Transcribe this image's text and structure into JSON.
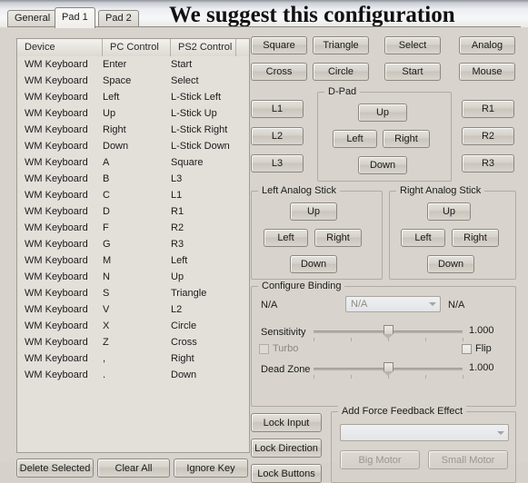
{
  "title": "We suggest this configuration",
  "tabs": [
    {
      "id": "general",
      "label": "General",
      "active": false
    },
    {
      "id": "pad1",
      "label": "Pad 1",
      "active": true
    },
    {
      "id": "pad2",
      "label": "Pad 2",
      "active": false
    }
  ],
  "table": {
    "columns": [
      "Device",
      "PC Control",
      "PS2 Control",
      ""
    ],
    "rows": [
      {
        "device": "WM Keyboard",
        "pc": "Enter",
        "ps2": "Start"
      },
      {
        "device": "WM Keyboard",
        "pc": "Space",
        "ps2": "Select"
      },
      {
        "device": "WM Keyboard",
        "pc": "Left",
        "ps2": "L-Stick Left"
      },
      {
        "device": "WM Keyboard",
        "pc": "Up",
        "ps2": "L-Stick Up"
      },
      {
        "device": "WM Keyboard",
        "pc": "Right",
        "ps2": "L-Stick Right"
      },
      {
        "device": "WM Keyboard",
        "pc": "Down",
        "ps2": "L-Stick Down"
      },
      {
        "device": "WM Keyboard",
        "pc": "A",
        "ps2": "Square"
      },
      {
        "device": "WM Keyboard",
        "pc": "B",
        "ps2": "L3"
      },
      {
        "device": "WM Keyboard",
        "pc": "C",
        "ps2": "L1"
      },
      {
        "device": "WM Keyboard",
        "pc": "D",
        "ps2": "R1"
      },
      {
        "device": "WM Keyboard",
        "pc": "F",
        "ps2": "R2"
      },
      {
        "device": "WM Keyboard",
        "pc": "G",
        "ps2": "R3"
      },
      {
        "device": "WM Keyboard",
        "pc": "M",
        "ps2": "Left"
      },
      {
        "device": "WM Keyboard",
        "pc": "N",
        "ps2": "Up"
      },
      {
        "device": "WM Keyboard",
        "pc": "S",
        "ps2": "Triangle"
      },
      {
        "device": "WM Keyboard",
        "pc": "V",
        "ps2": "L2"
      },
      {
        "device": "WM Keyboard",
        "pc": "X",
        "ps2": "Circle"
      },
      {
        "device": "WM Keyboard",
        "pc": "Z",
        "ps2": "Cross"
      },
      {
        "device": "WM Keyboard",
        "pc": ",",
        "ps2": "Right"
      },
      {
        "device": "WM Keyboard",
        "pc": ".",
        "ps2": "Down"
      }
    ]
  },
  "table_actions": {
    "delete_selected": "Delete Selected",
    "clear_all": "Clear All",
    "ignore_key": "Ignore Key"
  },
  "face_buttons": {
    "square": "Square",
    "triangle": "Triangle",
    "select": "Select",
    "analog": "Analog",
    "cross": "Cross",
    "circle": "Circle",
    "start": "Start",
    "mouse": "Mouse"
  },
  "shoulder": {
    "l1": "L1",
    "l2": "L2",
    "l3": "L3",
    "r1": "R1",
    "r2": "R2",
    "r3": "R3"
  },
  "dpad": {
    "legend": "D-Pad",
    "up": "Up",
    "left": "Left",
    "right": "Right",
    "down": "Down"
  },
  "left_stick": {
    "legend": "Left Analog Stick",
    "up": "Up",
    "left": "Left",
    "right": "Right",
    "down": "Down"
  },
  "right_stick": {
    "legend": "Right Analog Stick",
    "up": "Up",
    "left": "Left",
    "right": "Right",
    "down": "Down"
  },
  "configure_binding": {
    "legend": "Configure Binding",
    "binding_left": "N/A",
    "binding_combo": "N/A",
    "binding_right": "N/A",
    "sensitivity_label": "Sensitivity",
    "sensitivity_value": "1.000",
    "turbo_label": "Turbo",
    "flip_label": "Flip",
    "dead_zone_label": "Dead Zone",
    "dead_zone_value": "1.000"
  },
  "lock": {
    "lock_input": "Lock Input",
    "lock_direction": "Lock Direction",
    "lock_buttons": "Lock Buttons"
  },
  "force_feedback": {
    "legend": "Add Force Feedback Effect",
    "effect_combo": "",
    "big_motor": "Big Motor",
    "small_motor": "Small Motor"
  }
}
